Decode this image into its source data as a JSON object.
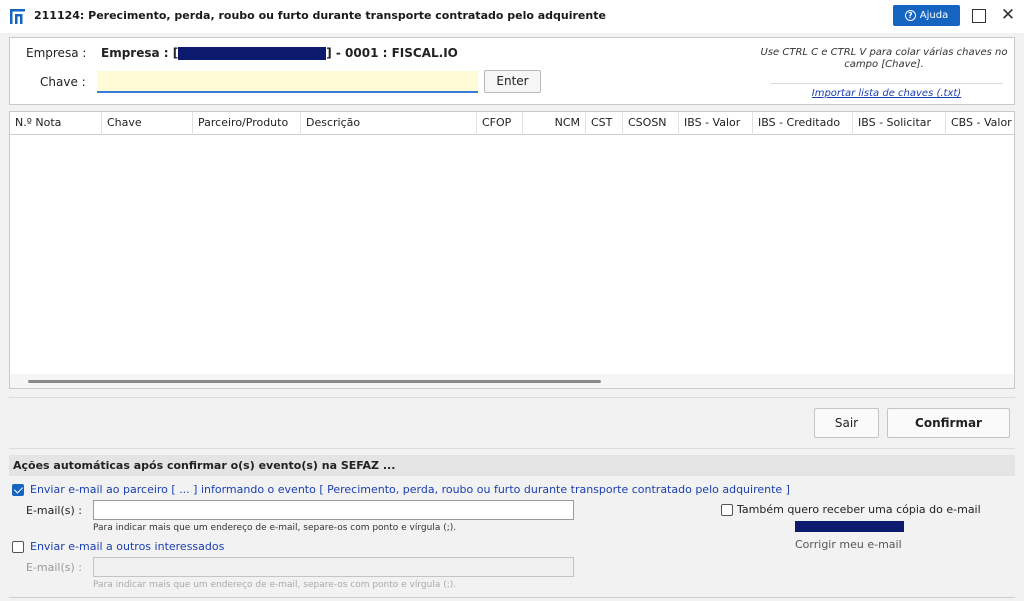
{
  "window": {
    "title": "211124: Perecimento, perda, roubo ou furto durante transporte contratado pelo adquirente",
    "help_label": "Ajuda",
    "icons": {
      "app": "app-logo-icon",
      "help": "question-circle-icon",
      "maximize": "maximize-icon",
      "close": "close-icon"
    },
    "close_glyph": "✕",
    "help_glyph": "?"
  },
  "header": {
    "empresa_label": "Empresa :",
    "empresa_prefix": "Empresa : [",
    "empresa_suffix": "] - 0001 : FISCAL.IO",
    "chave_label": "Chave :",
    "chave_value": "",
    "enter_label": "Enter",
    "hint": "Use CTRL C e CTRL V para colar várias chaves no campo [Chave].",
    "import_link": "Importar lista de chaves (.txt)"
  },
  "grid": {
    "columns": [
      "N.º Nota",
      "Chave",
      "Parceiro/Produto",
      "Descrição",
      "CFOP",
      "NCM",
      "CST",
      "CSOSN",
      "IBS - Valor",
      "IBS - Creditado",
      "IBS - Solicitar",
      "CBS - Valor"
    ],
    "rows": []
  },
  "buttons": {
    "sair": "Sair",
    "confirmar": "Confirmar"
  },
  "auto_actions": {
    "title": "Ações automáticas após confirmar o(s) evento(s) na SEFAZ ...",
    "send_partner": {
      "checked": true,
      "label": "Enviar e-mail ao parceiro [  ... ] informando o evento [ Perecimento, perda, roubo ou furto durante transporte contratado pelo adquirente ]",
      "email_label": "E-mail(s) :",
      "email_value": "",
      "hint": "Para indicar mais que um endereço de e-mail, separe-os com ponto e vírgula (;)."
    },
    "send_others": {
      "checked": false,
      "label": "Enviar e-mail a outros interessados",
      "email_label": "E-mail(s) :",
      "email_value": "",
      "hint": "Para indicar mais que um endereço de e-mail, separe-os com ponto e vírgula (;)."
    },
    "copy": {
      "checked": false,
      "label": "Também quero receber uma cópia do e-mail",
      "fix_email": "Corrigir meu e-mail"
    }
  },
  "colors": {
    "accent": "#1565c0",
    "link": "#1a3fb0",
    "redaction": "#0d1b6e",
    "chave_bg": "#fffbd6"
  }
}
